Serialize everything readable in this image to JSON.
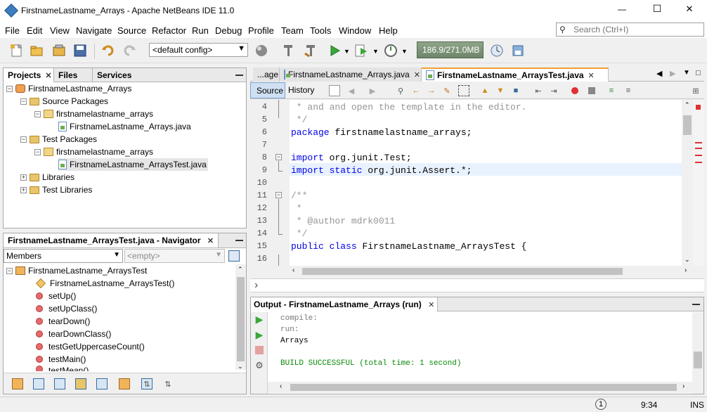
{
  "window": {
    "title": "FirstnameLastname_Arrays - Apache NetBeans IDE 11.0",
    "minimize_glyph": "—",
    "maximize_glyph": "☐",
    "close_glyph": "✕"
  },
  "menu": [
    "File",
    "Edit",
    "View",
    "Navigate",
    "Source",
    "Refactor",
    "Run",
    "Debug",
    "Profile",
    "Team",
    "Tools",
    "Window",
    "Help"
  ],
  "search": {
    "placeholder": "Search (Ctrl+I)"
  },
  "toolbar": {
    "config_value": "<default config>",
    "memory": "186.9/271.0MB"
  },
  "projects_panel": {
    "tabs": [
      "Projects",
      "Files",
      "Services"
    ],
    "tree": [
      {
        "label": "FirstnameLastname_Arrays"
      },
      {
        "label": "Source Packages"
      },
      {
        "label": "firstnamelastname_arrays"
      },
      {
        "label": "FirstnameLastname_Arrays.java"
      },
      {
        "label": "Test Packages"
      },
      {
        "label": "firstnamelastname_arrays"
      },
      {
        "label": "FirstnameLastname_ArraysTest.java"
      },
      {
        "label": "Libraries"
      },
      {
        "label": "Test Libraries"
      }
    ]
  },
  "navigator": {
    "title": "FirstnameLastname_ArraysTest.java - Navigator",
    "members_label": "Members",
    "filter_placeholder": "<empty>",
    "root": "FirstnameLastname_ArraysTest",
    "items": [
      "FirstnameLastname_ArraysTest()",
      "setUp()",
      "setUpClass()",
      "tearDown()",
      "tearDownClass()",
      "testGetUppercaseCount()",
      "testMain()",
      "testMean()"
    ]
  },
  "editor": {
    "tabs": [
      "...age",
      "FirstnameLastname_Arrays.java",
      "FirstnameLastname_ArraysTest.java"
    ],
    "source_tab": "Source",
    "history_tab": "History",
    "lines": [
      {
        "n": "4",
        "text": " * and and open the template in the editor."
      },
      {
        "n": "5",
        "text": " */"
      },
      {
        "n": "6",
        "text": "package firstnamelastname_arrays;"
      },
      {
        "n": "7",
        "text": ""
      },
      {
        "n": "8",
        "text": "import org.junit.Test;"
      },
      {
        "n": "9",
        "text": "import static org.junit.Assert.*;"
      },
      {
        "n": "10",
        "text": ""
      },
      {
        "n": "11",
        "text": "/**"
      },
      {
        "n": "12",
        "text": " *"
      },
      {
        "n": "13",
        "text": " * @author mdrk0011"
      },
      {
        "n": "14",
        "text": " */"
      },
      {
        "n": "15",
        "text": "public class FirstnameLastname_ArraysTest {"
      },
      {
        "n": "16",
        "text": ""
      }
    ]
  },
  "output": {
    "title": "Output - FirstnameLastname_Arrays (run)",
    "lines": [
      "compile:",
      "run:",
      "Arrays",
      "",
      "BUILD SUCCESSFUL (total time: 1 second)"
    ]
  },
  "status": {
    "notifications": "1",
    "time": "9:34",
    "mode": "INS"
  }
}
